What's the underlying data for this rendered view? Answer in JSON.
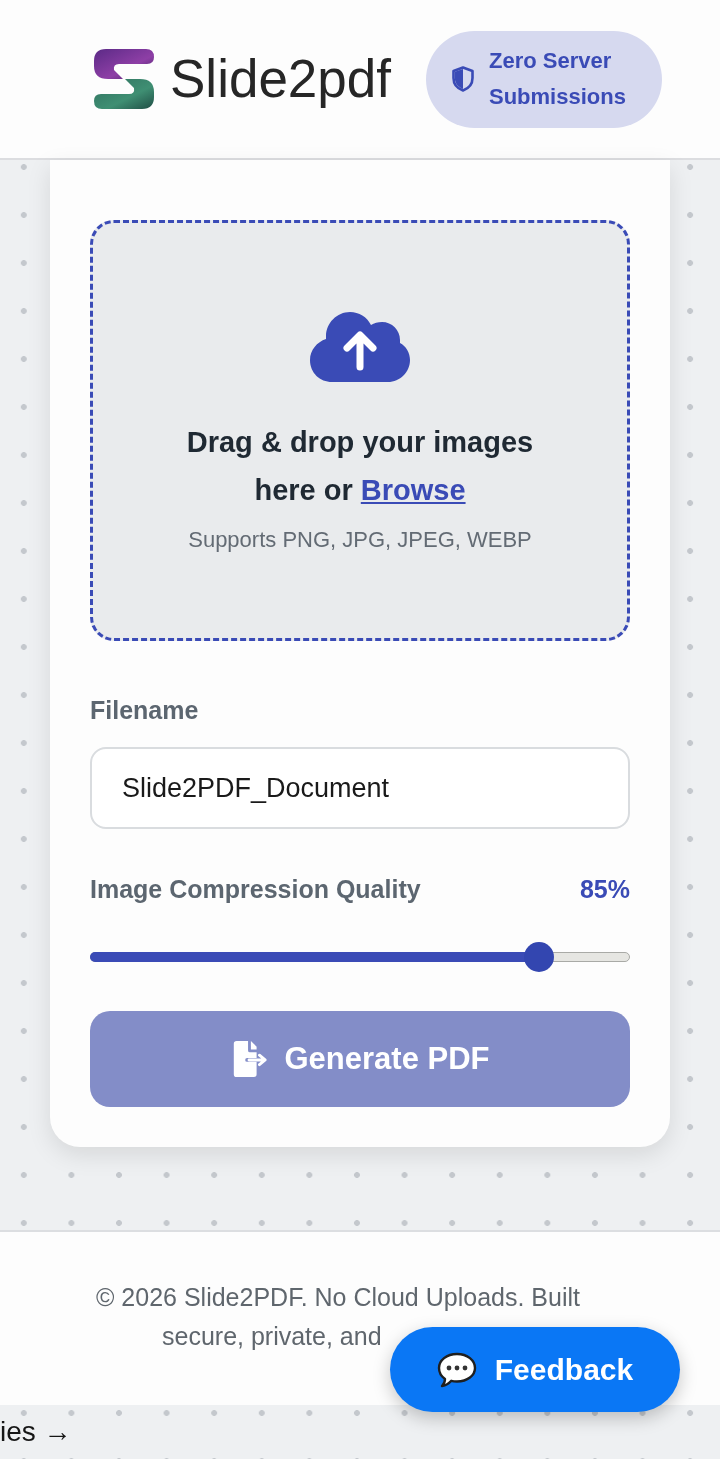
{
  "header": {
    "brand": "Slide2pdf",
    "badge": "Zero Server Submissions"
  },
  "upload": {
    "prompt": "Drag & drop your images here or",
    "browse_link": "Browse",
    "hint": "Supports PNG, JPG, JPEG, WEBP"
  },
  "filename": {
    "label": "Filename",
    "value": "Slide2PDF_Document"
  },
  "quality": {
    "label": "Image Compression Quality",
    "reading": "85%",
    "level": 0.85
  },
  "generate_button": {
    "label": "Generate PDF",
    "disabled": true
  },
  "footer": {
    "text": "© 2026 Slide2PDF. No Cloud Uploads. Built secure, private, and"
  },
  "feedback_button": {
    "label": "Feedback"
  },
  "bottom_link": {
    "label": "ies →"
  }
}
